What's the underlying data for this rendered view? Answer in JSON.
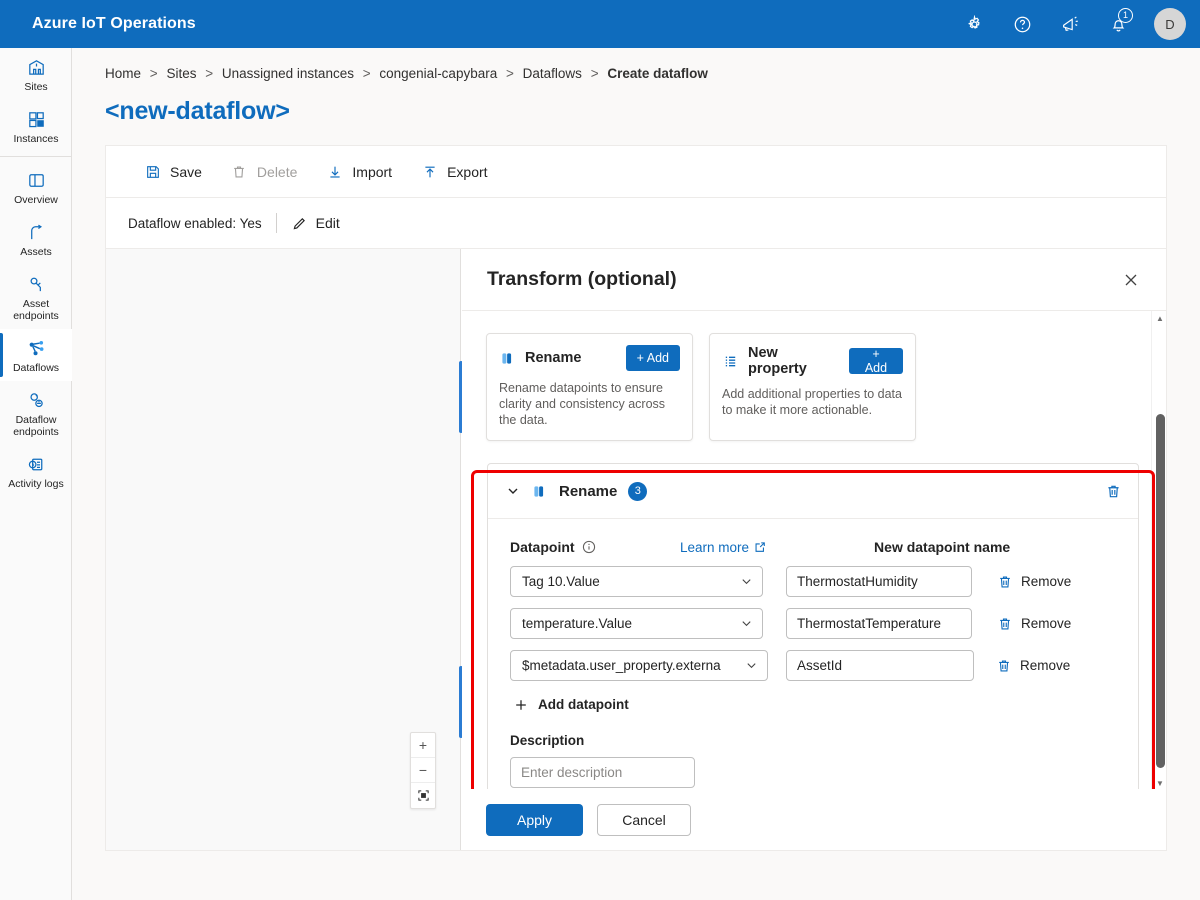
{
  "topbar": {
    "brand": "Azure IoT Operations",
    "icons": [
      {
        "name": "gear-icon",
        "label": "Settings"
      },
      {
        "name": "help-icon",
        "label": "Help"
      },
      {
        "name": "feedback-icon",
        "label": "Feedback"
      },
      {
        "name": "notifications-icon",
        "label": "Notifications",
        "badge": "1"
      }
    ],
    "avatar_initial": "D",
    "accent_color": "#0f6cbd"
  },
  "sidebar": {
    "items": [
      {
        "label": "Sites",
        "icon": "sites-icon",
        "selected": false
      },
      {
        "label": "Instances",
        "icon": "instances-icon",
        "selected": false
      },
      {
        "label": "Overview",
        "icon": "overview-icon",
        "selected": false
      },
      {
        "label": "Assets",
        "icon": "assets-icon",
        "selected": false
      },
      {
        "label": "Asset endpoints",
        "icon": "asset-endpoints-icon",
        "selected": false
      },
      {
        "label": "Dataflows",
        "icon": "dataflows-icon",
        "selected": true
      },
      {
        "label": "Dataflow endpoints",
        "icon": "dataflow-endpoints-icon",
        "selected": false
      },
      {
        "label": "Activity logs",
        "icon": "activity-logs-icon",
        "selected": false
      }
    ]
  },
  "breadcrumb": {
    "items": [
      "Home",
      "Sites",
      "Unassigned instances",
      "congenial-capybara",
      "Dataflows",
      "Create dataflow"
    ],
    "separator": ">"
  },
  "page": {
    "title": "<new-dataflow>"
  },
  "toolbar": {
    "save_label": "Save",
    "delete_label": "Delete",
    "import_label": "Import",
    "export_label": "Export"
  },
  "statusbar": {
    "enabled_text": "Dataflow enabled: Yes",
    "edit_label": "Edit"
  },
  "canvas": {
    "zoom_in": "+",
    "zoom_out": "−",
    "fit_label": "fit-to-screen"
  },
  "panel": {
    "title": "Transform (optional)",
    "close_label": "Close",
    "cards": [
      {
        "title": "Rename",
        "icon": "rename-icon",
        "add_label": "+ Add",
        "description": "Rename datapoints to ensure clarity and consistency across the data."
      },
      {
        "title": "New property",
        "icon": "new-property-icon",
        "add_label": "+ Add",
        "description": "Add additional properties to data to make it more actionable."
      }
    ],
    "section": {
      "title": "Rename",
      "count": "3",
      "column_datapoint": "Datapoint",
      "learn_more": "Learn more",
      "column_new_name": "New datapoint name",
      "rows": [
        {
          "datapoint": "Tag 10.Value",
          "new_name": "ThermostatHumidity",
          "remove_label": "Remove"
        },
        {
          "datapoint": "temperature.Value",
          "new_name": "ThermostatTemperature",
          "remove_label": "Remove"
        },
        {
          "datapoint": "$metadata.user_property.externa",
          "new_name": "AssetId",
          "remove_label": "Remove"
        }
      ],
      "add_datapoint_label": "Add datapoint",
      "description_label": "Description",
      "description_value": "",
      "description_placeholder": "Enter description"
    },
    "apply_label": "Apply",
    "cancel_label": "Cancel",
    "highlight_color": "#ee0000"
  }
}
